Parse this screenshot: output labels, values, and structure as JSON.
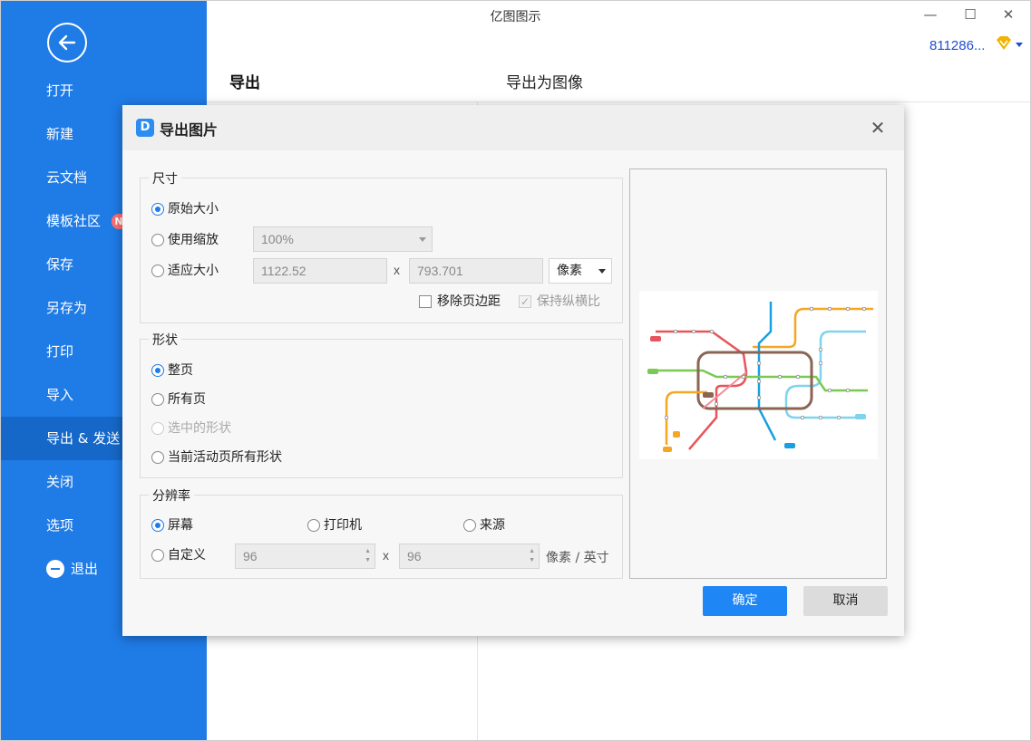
{
  "window": {
    "title": "亿图图示",
    "minimize": "—",
    "maximize": "☐",
    "close": "✕",
    "user_id": "811286...",
    "vip_color": "#f2b300"
  },
  "sidebar": {
    "background": "#1f7be6",
    "items": [
      {
        "label": "打开"
      },
      {
        "label": "新建"
      },
      {
        "label": "云文档"
      },
      {
        "label": "模板社区",
        "badge": "N"
      },
      {
        "label": "保存"
      },
      {
        "label": "另存为"
      },
      {
        "label": "打印"
      },
      {
        "label": "导入"
      },
      {
        "label": "导出 & 发送",
        "active": true
      },
      {
        "label": "关闭"
      },
      {
        "label": "选项"
      },
      {
        "label": "退出"
      }
    ]
  },
  "main": {
    "heading": "导出",
    "subheading": "导出为图像"
  },
  "dialog": {
    "title": "导出图片",
    "logo": "D",
    "close": "✕",
    "size_group": {
      "legend": "尺寸",
      "original": "原始大小",
      "use_scale": "使用缩放",
      "scale_value": "100%",
      "fit_size": "适应大小",
      "width": "1122.52",
      "times": "x",
      "height": "793.701",
      "unit": "像素",
      "remove_margin": "移除页边距",
      "keep_ratio": "保持纵横比",
      "selected": "original"
    },
    "shape_group": {
      "legend": "形状",
      "whole_page": "整页",
      "all_pages": "所有页",
      "selected_shapes": "选中的形状",
      "current_page_all": "当前活动页所有形状",
      "selected": "whole_page"
    },
    "resolution_group": {
      "legend": "分辨率",
      "screen": "屏幕",
      "printer": "打印机",
      "source": "来源",
      "custom": "自定义",
      "dpi_x": "96",
      "times": "x",
      "dpi_y": "96",
      "unit": "像素 / 英寸",
      "selected": "screen"
    },
    "ok": "确定",
    "cancel": "取消"
  }
}
